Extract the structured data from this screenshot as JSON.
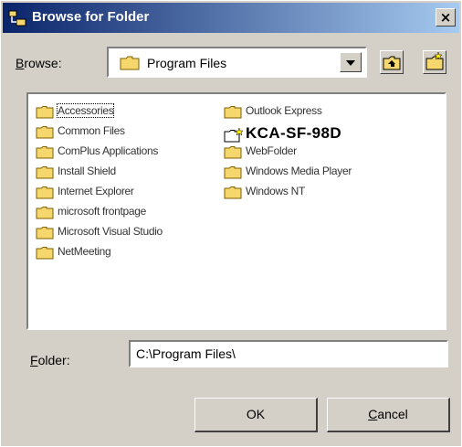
{
  "window": {
    "title": "Browse for Folder",
    "close_label": "×"
  },
  "browse": {
    "label_underlined": "B",
    "label_rest": "rowse:",
    "selected": "Program Files"
  },
  "folders": [
    {
      "name": "Accessories",
      "selected": true
    },
    {
      "name": "Common Files"
    },
    {
      "name": "ComPlus Applications"
    },
    {
      "name": "Install Shield"
    },
    {
      "name": "Internet Explorer"
    },
    {
      "name": "microsoft frontpage"
    },
    {
      "name": "Microsoft Visual Studio"
    },
    {
      "name": "NetMeeting"
    },
    {
      "name": "Outlook Express"
    },
    {
      "name": "KCA-SF-98D",
      "big": true
    },
    {
      "name": "WebFolder"
    },
    {
      "name": "Windows Media Player"
    },
    {
      "name": "Windows NT"
    }
  ],
  "folder": {
    "label_underlined": "F",
    "label_rest": "older:",
    "value": "C:\\Program Files\\"
  },
  "buttons": {
    "ok": "OK",
    "cancel_underlined": "C",
    "cancel_rest": "ancel"
  },
  "colors": {
    "title_start": "#0a246a",
    "title_end": "#a6caf0",
    "face": "#d4d0c8",
    "folder": "#f5d76e"
  }
}
